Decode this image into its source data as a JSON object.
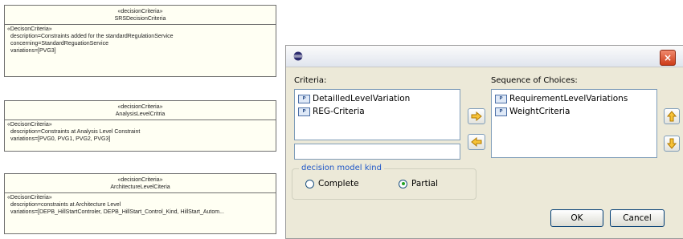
{
  "diagram": {
    "boxes": [
      {
        "stereotype": "«decisionCriteria»",
        "name": "SRSDecisionCriteria",
        "section": "«DecisonCriteria»",
        "attrs": [
          "description=Constraints added for the standardRegulationService",
          "concerning=StandardReguationService",
          "variations=[PVG3]"
        ]
      },
      {
        "stereotype": "«decisionCriteria»",
        "name": "AnalysisLevelCritria",
        "section": "«DecisonCriteria»",
        "attrs": [
          "description=Constraints at Analysis Level Constraint",
          "variations=[PVG0, PVG1, PVG2, PVG3]"
        ]
      },
      {
        "stereotype": "«decisionCriteria»",
        "name": "ArchitectureLevelCiteria",
        "section": "«DecisonCriteria»",
        "attrs": [
          "description=constraints at Architecture Level",
          "variations=[DEPB_HillStartControler, DEPB_HillStart_Control_Kind, HillStart_Autom..."
        ]
      }
    ]
  },
  "dialog": {
    "close_glyph": "×",
    "criteria_label": "Criteria:",
    "criteria_items": [
      "DetailledLevelVariation",
      "REG-Criteria"
    ],
    "sequence_label": "Sequence of Choices:",
    "sequence_items": [
      "RequirementLevelVariations",
      "WeightCriteria"
    ],
    "item_icon_text": "P",
    "group_label": "decision model kind",
    "options": [
      {
        "label": "Complete",
        "selected": false
      },
      {
        "label": "Partial",
        "selected": true
      }
    ],
    "ok_label": "OK",
    "cancel_label": "Cancel",
    "colors": {
      "arrow_fill": "#f6c238",
      "arrow_stroke": "#b27a00",
      "selected_radio": "#21a121"
    }
  }
}
